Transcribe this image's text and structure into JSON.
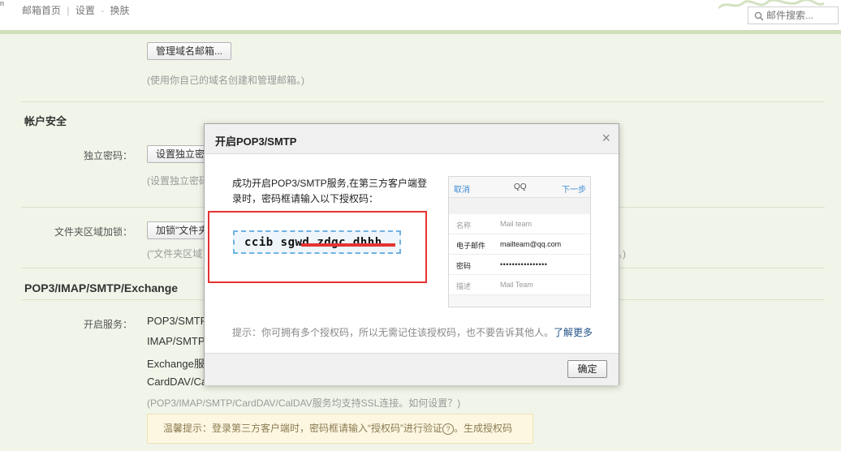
{
  "topbar": {
    "logo_fragment": "n",
    "nav_home": "邮箱首页",
    "nav_sep": "|",
    "nav_settings": "设置",
    "nav_dash": "-",
    "nav_skin": "换肤",
    "search_placeholder": "邮件搜索..."
  },
  "domain_mail": {
    "button": "管理域名邮箱...",
    "hint": "(使用你自己的域名创建和管理邮箱。)"
  },
  "account_security": {
    "title": "帐户安全",
    "independent_password": {
      "label": "独立密码：",
      "button": "设置独立密码",
      "hint": "(设置独立密码"
    },
    "folder_lock": {
      "label": "文件夹区域加锁：",
      "button": "加锁\"文件夹",
      "hint": "(\"文件夹区域",
      "hint_tail": "。)"
    }
  },
  "pop3": {
    "title": "POP3/IMAP/SMTP/Exchange",
    "label": "开启服务：",
    "services": [
      "POP3/SMTP",
      "IMAP/SMTP",
      "Exchange服",
      "CardDAV/CalD"
    ],
    "ssl_note": "(POP3/IMAP/SMTP/CardDAV/CalDAV服务均支持SSL连接。如何设置？)",
    "warm_tip": "温馨提示：登录第三方客户端时，密码框请输入“授权码”进行验证",
    "warm_help": "?",
    "warm_action": "。生成授权码"
  },
  "modal": {
    "title": "开启POP3/SMTP",
    "close": "×",
    "message": "成功开启POP3/SMTP服务,在第三方客户端登录时，密码框请输入以下授权码：",
    "code": "ccib sgwd zdgc dhhh",
    "phone": {
      "cancel": "取消",
      "title": "QQ",
      "next": "下一步",
      "rows": [
        {
          "key": "名称",
          "value": "Mail team",
          "key_color": "#999",
          "value_color": "#999"
        },
        {
          "key": "电子邮件",
          "value": "mailteam@qq.com",
          "key_color": "#222",
          "value_color": "#222"
        },
        {
          "key": "密码",
          "value": "••••••••••••••••",
          "key_color": "#222",
          "value_color": "#222"
        },
        {
          "key": "描述",
          "value": "Mail Team",
          "key_color": "#999",
          "value_color": "#999"
        }
      ]
    },
    "tip": "提示：你可拥有多个授权码，所以无需记住该授权码，也不要告诉其他人。",
    "tip_link": "了解更多",
    "ok": "确定"
  },
  "colors": {
    "page_bg": "#f1f5e9",
    "red_highlight": "#e53333",
    "link_blue": "#225388",
    "phone_blue": "#3d8bd3"
  }
}
